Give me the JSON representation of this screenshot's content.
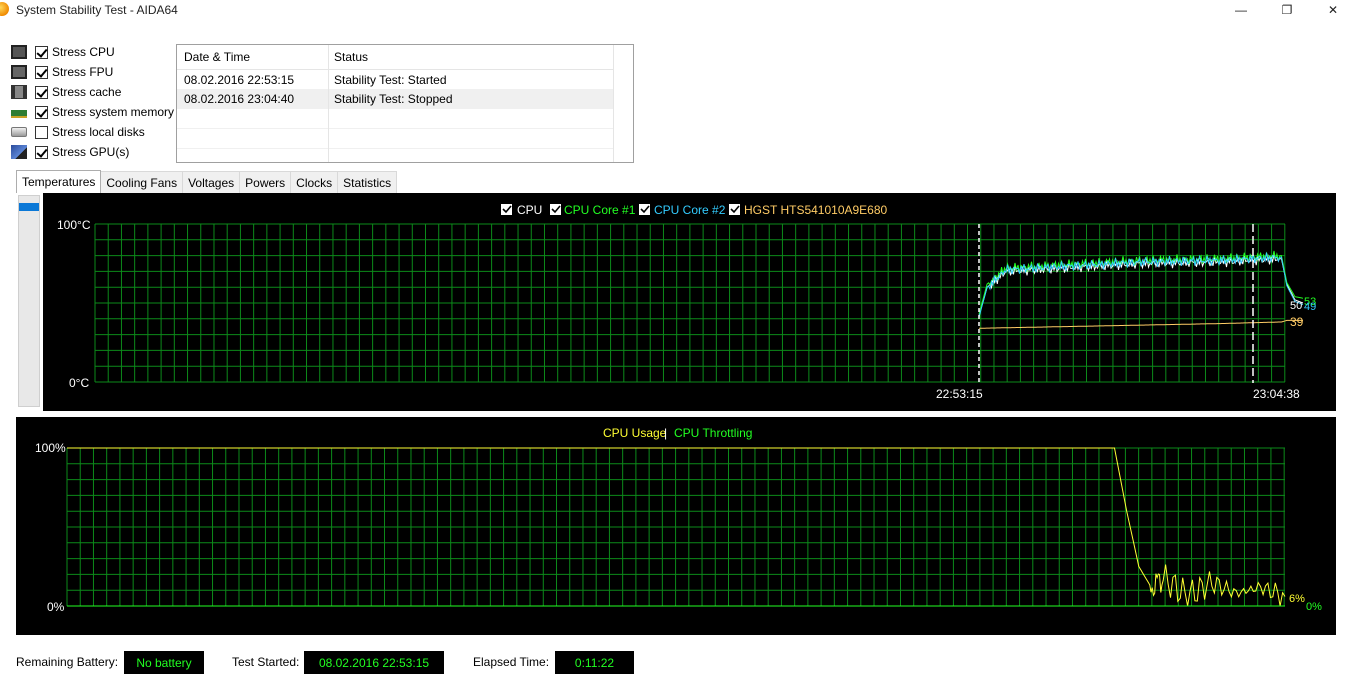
{
  "window": {
    "title": "System Stability Test - AIDA64",
    "min_symbol": "—",
    "max_symbol": "❐",
    "close_symbol": "✕"
  },
  "stress": [
    {
      "label": "Stress CPU",
      "checked": true,
      "icon": "cpu-icon"
    },
    {
      "label": "Stress FPU",
      "checked": true,
      "icon": "fpu-icon"
    },
    {
      "label": "Stress cache",
      "checked": true,
      "icon": "cache-icon"
    },
    {
      "label": "Stress system memory",
      "checked": true,
      "icon": "memory-icon"
    },
    {
      "label": "Stress local disks",
      "checked": false,
      "icon": "disk-icon"
    },
    {
      "label": "Stress GPU(s)",
      "checked": true,
      "icon": "gpu-icon"
    }
  ],
  "log": {
    "headers": [
      "Date & Time",
      "Status"
    ],
    "rows": [
      {
        "datetime": "08.02.2016 22:53:15",
        "status": "Stability Test: Started"
      },
      {
        "datetime": "08.02.2016 23:04:40",
        "status": "Stability Test: Stopped"
      }
    ]
  },
  "tabs": [
    "Temperatures",
    "Cooling Fans",
    "Voltages",
    "Powers",
    "Clocks",
    "Statistics"
  ],
  "active_tab": "Temperatures",
  "colors": {
    "grid": "#0c8a1a",
    "cpu": "#ffffff",
    "core1": "#22ff22",
    "core2": "#33ccff",
    "hdd": "#ffcc66",
    "usage": "#ffff33",
    "throttling": "#22ff22",
    "axis_text": "#ffffff"
  },
  "chart_data": [
    {
      "type": "line",
      "legend": [
        "CPU",
        "CPU Core #1",
        "CPU Core #2",
        "HGST HTS541010A9E680"
      ],
      "y_top_label": "100°C",
      "y_bottom_label": "0°C",
      "ylim": [
        0,
        100
      ],
      "x_labels": [
        "22:53:15",
        "23:04:38"
      ],
      "end_labels": {
        "core1": "53",
        "cpu": "50",
        "core2": "49",
        "hdd": "39"
      },
      "series": [
        {
          "name": "CPU",
          "x": [
            0,
            0.3,
            1,
            3,
            6,
            9,
            11.2,
            11.4,
            11.7,
            12
          ],
          "y": [
            42,
            60,
            70,
            72,
            75,
            76,
            78,
            62,
            52,
            50
          ]
        },
        {
          "name": "CPU Core #1",
          "x": [
            0,
            0.3,
            1,
            3,
            6,
            9,
            11.2,
            11.4,
            11.7,
            12
          ],
          "y": [
            43,
            62,
            72,
            74,
            77,
            78,
            80,
            63,
            54,
            53
          ]
        },
        {
          "name": "CPU Core #2",
          "x": [
            0,
            0.3,
            1,
            3,
            6,
            9,
            11.2,
            11.4,
            11.7,
            12
          ],
          "y": [
            41,
            60,
            71,
            73,
            76,
            77,
            79,
            61,
            51,
            49
          ]
        },
        {
          "name": "HGST HTS541010A9E680",
          "x": [
            0,
            3,
            6,
            9,
            11.2,
            11.4,
            12
          ],
          "y": [
            34,
            35,
            36,
            37,
            38,
            39,
            39
          ]
        }
      ]
    },
    {
      "type": "line",
      "legend": [
        "CPU Usage",
        "CPU Throttling"
      ],
      "y_top_label": "100%",
      "y_bottom_label": "0%",
      "ylim": [
        0,
        100
      ],
      "end_labels": {
        "usage": "6%",
        "throttling": "0%"
      },
      "series": [
        {
          "name": "CPU Usage",
          "x": [
            0,
            0.86,
            0.87,
            0.88,
            0.89,
            0.9,
            0.92,
            0.94,
            0.96,
            0.98,
            1.0
          ],
          "y": [
            100,
            100,
            60,
            25,
            12,
            18,
            6,
            15,
            8,
            12,
            6
          ]
        },
        {
          "name": "CPU Throttling",
          "x": [
            0,
            1
          ],
          "y": [
            0,
            0
          ]
        }
      ]
    }
  ],
  "footer": {
    "battery_label": "Remaining Battery:",
    "battery_value": "No battery",
    "started_label": "Test Started:",
    "started_value": "08.02.2016 22:53:15",
    "elapsed_label": "Elapsed Time:",
    "elapsed_value": "0:11:22"
  }
}
